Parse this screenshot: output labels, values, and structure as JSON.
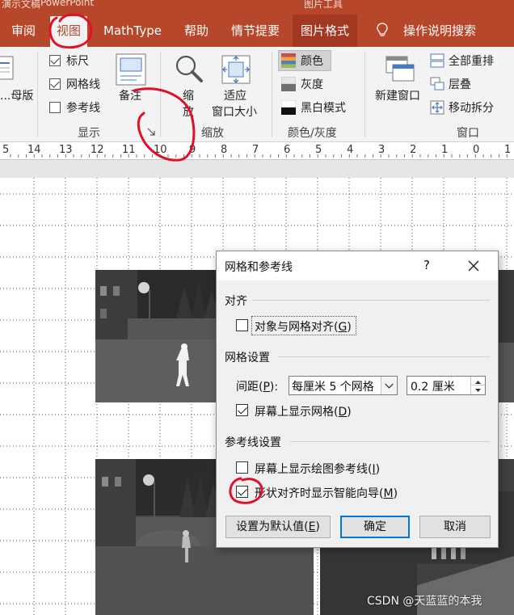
{
  "window": {
    "title_fragment_left": "演示文稿",
    "title_fragment_app": "PowerPoint",
    "title_fragment_right": "图片工具"
  },
  "tabs": [
    {
      "label": "审阅",
      "active": false
    },
    {
      "label": "视图",
      "active": true
    },
    {
      "label": "MathType",
      "active": false
    },
    {
      "label": "帮助",
      "active": false
    },
    {
      "label": "情节提要",
      "active": false
    },
    {
      "label": "图片格式",
      "active": false,
      "context": true
    }
  ],
  "search": {
    "label": "操作说明搜索",
    "icon": "lightbulb-icon"
  },
  "ribbon": {
    "master": {
      "label": "...母版"
    },
    "show": {
      "group_name": "显示",
      "ruler": {
        "label": "标尺",
        "checked": true
      },
      "gridlines": {
        "label": "网格线",
        "checked": true
      },
      "guides": {
        "label": "参考线",
        "checked": false
      },
      "notes_label": "备注"
    },
    "zoom": {
      "group_name": "缩放",
      "zoom_label_1": "缩",
      "zoom_label_2": "放",
      "fit_label_1": "适应",
      "fit_label_2": "窗口大小"
    },
    "color": {
      "group_name": "颜色/灰度",
      "color_label": "颜色",
      "gray_label": "灰度",
      "bw_label": "黑白模式"
    },
    "window": {
      "group_name": "窗口",
      "new_window_label": "新建窗口",
      "arrange_all_label": "全部重排",
      "cascade_label": "层叠",
      "move_split_label": "移动拆分"
    }
  },
  "ruler": {
    "ticks": [
      "5",
      "14",
      "13",
      "12",
      "11",
      "10",
      "9",
      "8",
      "7",
      "6",
      "5",
      "4",
      "3",
      "2",
      "1",
      "0",
      "1"
    ]
  },
  "dialog": {
    "title": "网格和参考线",
    "help": "?",
    "snap_section": "对齐",
    "snap_to_grid": {
      "label": "对象与网格对齐(",
      "hotkey": "G",
      "suffix": ")",
      "checked": false
    },
    "grid_section": "网格设置",
    "spacing_label": "间距(",
    "spacing_hotkey": "P",
    "spacing_suffix": "):",
    "spacing_option": "每厘米 5 个网格",
    "spacing_value": "0.2 厘米",
    "show_grid": {
      "label": "屏幕上显示网格(",
      "hotkey": "D",
      "suffix": ")",
      "checked": true
    },
    "guide_section": "参考线设置",
    "show_guides": {
      "label": "屏幕上显示绘图参考线(",
      "hotkey": "I",
      "suffix": ")",
      "checked": false
    },
    "smart_guides": {
      "label": "形状对齐时显示智能向导(",
      "hotkey": "M",
      "suffix": ")",
      "checked": true
    },
    "set_default": {
      "label": "设置为默认值(",
      "hotkey": "E",
      "suffix": ")"
    },
    "ok_label": "确定",
    "cancel_label": "取消"
  },
  "watermark": "CSDN @天蓝蓝的本我",
  "colors": {
    "accent": "#b7472a",
    "context_tab": "#a1381f",
    "default_button_border": "#0078d7",
    "annotation_red": "#e0102a"
  }
}
